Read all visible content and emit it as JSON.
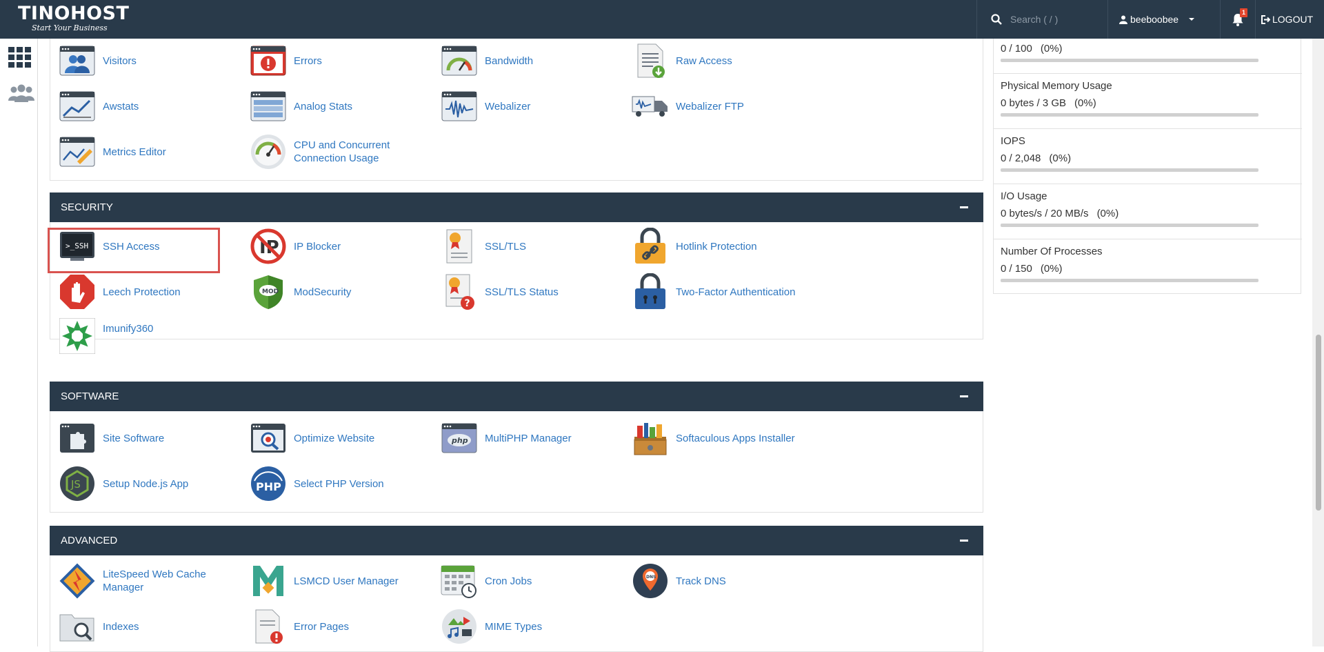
{
  "header": {
    "brand": "TINOHOST",
    "tagline": "Start Your Business",
    "search_placeholder": "Search ( / )",
    "username": "beeboobee",
    "notification_count": "1",
    "logout_label": "LOGOUT"
  },
  "sections": {
    "metrics": {
      "items": [
        {
          "label": "Visitors"
        },
        {
          "label": "Errors"
        },
        {
          "label": "Bandwidth"
        },
        {
          "label": "Raw Access"
        },
        {
          "label": "Awstats"
        },
        {
          "label": "Analog Stats"
        },
        {
          "label": "Webalizer"
        },
        {
          "label": "Webalizer FTP"
        },
        {
          "label": "Metrics Editor"
        },
        {
          "label": "CPU and Concurrent Connection Usage"
        }
      ]
    },
    "security": {
      "title": "SECURITY",
      "items": [
        {
          "label": "SSH Access"
        },
        {
          "label": "IP Blocker"
        },
        {
          "label": "SSL/TLS"
        },
        {
          "label": "Hotlink Protection"
        },
        {
          "label": "Leech Protection"
        },
        {
          "label": "ModSecurity"
        },
        {
          "label": "SSL/TLS Status"
        },
        {
          "label": "Two-Factor Authentication"
        },
        {
          "label": "Imunify360"
        }
      ]
    },
    "software": {
      "title": "SOFTWARE",
      "items": [
        {
          "label": "Site Software"
        },
        {
          "label": "Optimize Website"
        },
        {
          "label": "MultiPHP Manager"
        },
        {
          "label": "Softaculous Apps Installer"
        },
        {
          "label": "Setup Node.js App"
        },
        {
          "label": "Select PHP Version"
        }
      ]
    },
    "advanced": {
      "title": "ADVANCED",
      "items": [
        {
          "label": "LiteSpeed Web Cache Manager"
        },
        {
          "label": "LSMCD User Manager"
        },
        {
          "label": "Cron Jobs"
        },
        {
          "label": "Track DNS"
        },
        {
          "label": "Indexes"
        },
        {
          "label": "Error Pages"
        },
        {
          "label": "MIME Types"
        }
      ]
    }
  },
  "stats": [
    {
      "label": "",
      "value": "0 / 100",
      "percent": "(0%)",
      "fraction": 0
    },
    {
      "label": "Physical Memory Usage",
      "value": "0 bytes / 3 GB",
      "percent": "(0%)",
      "fraction": 0
    },
    {
      "label": "IOPS",
      "value": "0 / 2,048",
      "percent": "(0%)",
      "fraction": 0
    },
    {
      "label": "I/O Usage",
      "value": "0 bytes/s / 20 MB/s",
      "percent": "(0%)",
      "fraction": 0
    },
    {
      "label": "Number Of Processes",
      "value": "0 / 150",
      "percent": "(0%)",
      "fraction": 0
    }
  ],
  "colors": {
    "header_bg": "#293a4a",
    "link": "#2f77c0",
    "highlight": "#d9534f"
  }
}
